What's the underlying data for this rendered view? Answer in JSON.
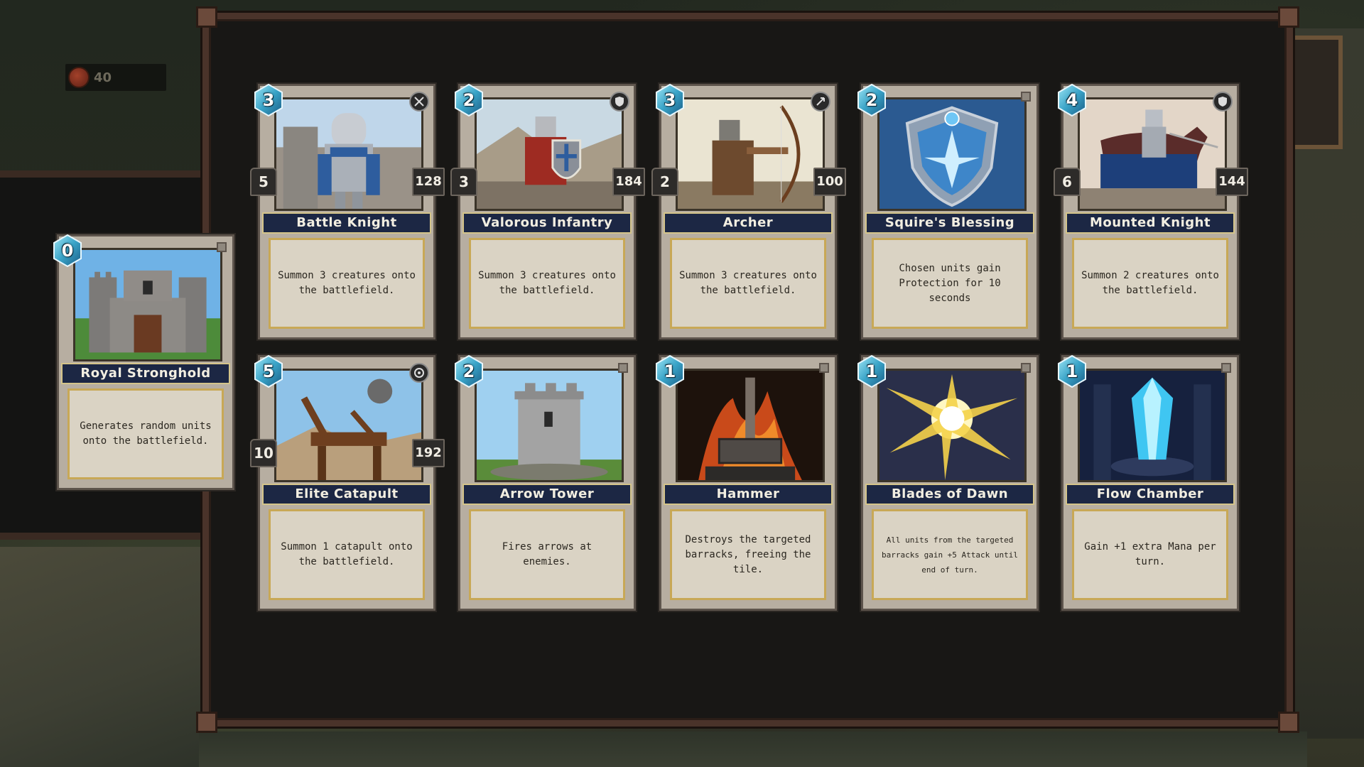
{
  "resource": {
    "value": "40",
    "icon": "coin-icon",
    "color": "#a3412a"
  },
  "cards": [
    {
      "id": "royal-stronghold",
      "name": "Royal Stronghold",
      "cost": "0",
      "description": "Generates random units onto the battlefield.",
      "art": "castle"
    },
    {
      "id": "battle-knight",
      "name": "Battle Knight",
      "cost": "3",
      "description": "Summon 3 creatures onto the battlefield.",
      "type_icon": "crossed-swords-icon",
      "stat_left": "5",
      "stat_right": "128",
      "art": "knight"
    },
    {
      "id": "valorous-infantry",
      "name": "Valorous Infantry",
      "cost": "2",
      "description": "Summon 3 creatures onto the battlefield.",
      "type_icon": "shield-icon",
      "stat_left": "3",
      "stat_right": "184",
      "art": "infantry"
    },
    {
      "id": "archer",
      "name": "Archer",
      "cost": "3",
      "description": "Summon 3 creatures onto the battlefield.",
      "type_icon": "bow-icon",
      "stat_left": "2",
      "stat_right": "100",
      "art": "archer"
    },
    {
      "id": "squires-blessing",
      "name": "Squire's Blessing",
      "cost": "2",
      "description": "Chosen units gain Protection for 10 seconds",
      "art": "blessing"
    },
    {
      "id": "mounted-knight",
      "name": "Mounted Knight",
      "cost": "4",
      "description": "Summon 2 creatures onto the battlefield.",
      "type_icon": "shield-icon",
      "stat_left": "6",
      "stat_right": "144",
      "art": "mounted"
    },
    {
      "id": "elite-catapult",
      "name": "Elite Catapult",
      "cost": "5",
      "description": "Summon 1 catapult onto the battlefield.",
      "type_icon": "target-icon",
      "stat_left": "10",
      "stat_right": "192",
      "art": "catapult"
    },
    {
      "id": "arrow-tower",
      "name": "Arrow Tower",
      "cost": "2",
      "description": "Fires arrows at enemies.",
      "art": "tower"
    },
    {
      "id": "hammer",
      "name": "Hammer",
      "cost": "1",
      "description": "Destroys the targeted barracks, freeing the tile.",
      "art": "hammer"
    },
    {
      "id": "blades-of-dawn",
      "name": "Blades of Dawn",
      "cost": "1",
      "description": "All units from the targeted barracks gain +5 Attack until end of turn.",
      "art": "dawn"
    },
    {
      "id": "flow-chamber",
      "name": "Flow Chamber",
      "cost": "1",
      "description": "Gain +1 extra Mana per turn.",
      "art": "crystal"
    }
  ]
}
